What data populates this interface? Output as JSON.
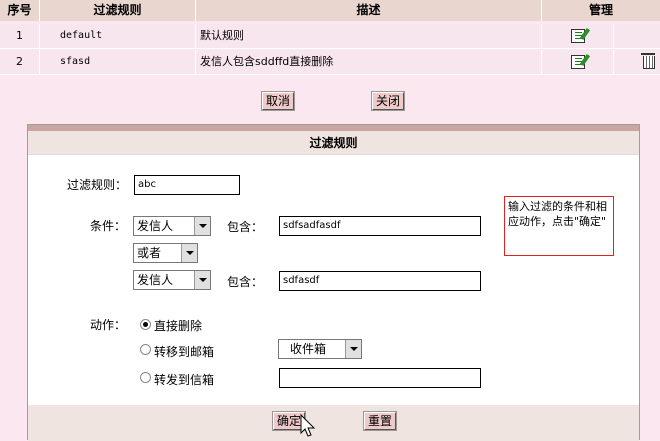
{
  "table": {
    "headers": {
      "index": "序号",
      "rule": "过滤规则",
      "desc": "描述",
      "manage": "管理"
    },
    "rows": [
      {
        "index": "1",
        "rule": "default",
        "desc": "默认规则"
      },
      {
        "index": "2",
        "rule": "sfasd",
        "desc": "发信人包含sddffd直接删除"
      }
    ]
  },
  "actions": {
    "cancel": "取消",
    "close": "关闭"
  },
  "dialog": {
    "title": "过滤规则",
    "rule_label": "过滤规则：",
    "rule_value": "abc",
    "condition_label": "条件：",
    "cond1_field": "发信人",
    "contains_label": "包含：",
    "cond1_value": "sdfsadfasdf",
    "logic": "或者",
    "cond2_field": "发信人",
    "cond2_value": "sdfasdf",
    "hint": "输入过滤的条件和相应动作，点击\"确定\"",
    "action_label": "动作：",
    "action_delete": "直接删除",
    "action_move": "转移到邮箱",
    "move_target": "收件箱",
    "action_forward": "转发到信箱",
    "forward_value": "",
    "ok": "确定",
    "reset": "重置"
  }
}
